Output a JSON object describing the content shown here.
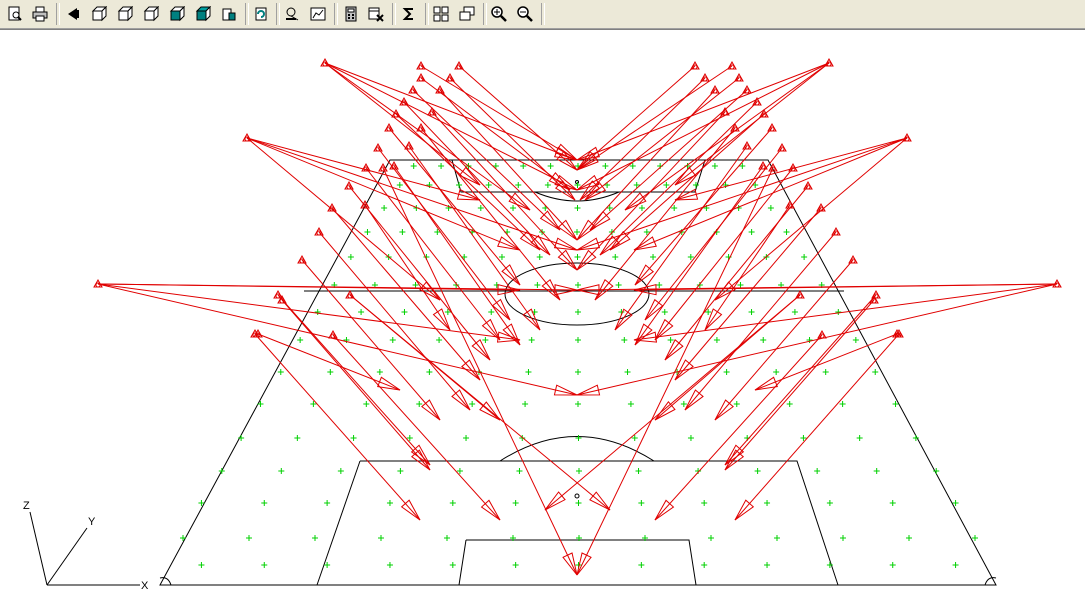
{
  "toolbar": {
    "buttons": [
      {
        "name": "print-preview-button",
        "icon": "print-preview-icon"
      },
      {
        "name": "print-button",
        "icon": "printer-icon"
      },
      {
        "name": "view-left-button",
        "icon": "view-left-icon"
      },
      {
        "name": "view-front-button",
        "icon": "cube-front-icon"
      },
      {
        "name": "view-back-button",
        "icon": "cube-back-icon"
      },
      {
        "name": "view-side-button",
        "icon": "cube-side-icon"
      },
      {
        "name": "view-top-button",
        "icon": "cube-top-icon"
      },
      {
        "name": "view-iso-button",
        "icon": "cube-iso-icon"
      },
      {
        "name": "view-3d-button",
        "icon": "cube-3d-icon"
      },
      {
        "name": "rotate-button",
        "icon": "rotate-icon"
      },
      {
        "name": "aim-button",
        "icon": "aim-icon"
      },
      {
        "name": "chart-button",
        "icon": "chart-icon"
      },
      {
        "name": "calculator-button",
        "icon": "calculator-icon"
      },
      {
        "name": "delete-table-button",
        "icon": "table-delete-icon"
      },
      {
        "name": "sum-button",
        "icon": "sigma-icon"
      },
      {
        "name": "tile-windows-button",
        "icon": "tile-icon"
      },
      {
        "name": "cascade-windows-button",
        "icon": "cascade-icon"
      },
      {
        "name": "zoom-in-button",
        "icon": "zoom-in-icon"
      },
      {
        "name": "zoom-out-button",
        "icon": "zoom-out-icon"
      }
    ]
  },
  "axes": {
    "x": "X",
    "y": "Y",
    "z": "Z"
  },
  "colors": {
    "field": "#000000",
    "luminaire": "#e00000",
    "grid_point": "#00d000",
    "toolbar": "#ece9d8"
  }
}
